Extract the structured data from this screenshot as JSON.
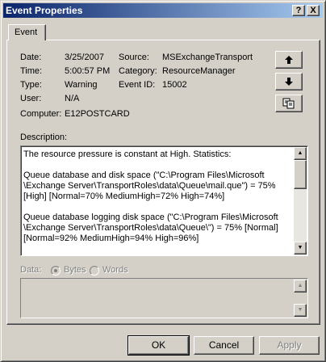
{
  "window": {
    "title": "Event Properties",
    "help_button": "?",
    "close_button": "X"
  },
  "tabs": [
    {
      "label": "Event"
    }
  ],
  "event": {
    "date_label": "Date:",
    "date": "3/25/2007",
    "source_label": "Source:",
    "source": "MSExchangeTransport",
    "time_label": "Time:",
    "time": "5:00:57 PM",
    "category_label": "Category:",
    "category": "ResourceManager",
    "type_label": "Type:",
    "type": "Warning",
    "event_id_label": "Event ID:",
    "event_id": "15002",
    "user_label": "User:",
    "user": "N/A",
    "computer_label": "Computer:",
    "computer": "E12POSTCARD"
  },
  "nav_buttons": {
    "previous_icon": "up-arrow-icon",
    "next_icon": "down-arrow-icon",
    "copy_icon": "copy-icon"
  },
  "description": {
    "label": "Description:",
    "text": "The resource pressure is constant at High. Statistics:\n\nQueue database and disk space (\"C:\\Program Files\\Microsoft\n\\Exchange Server\\TransportRoles\\data\\Queue\\mail.que\") = 75%\n[High] [Normal=70% MediumHigh=72% High=74%]\n\nQueue database logging disk space (\"C:\\Program Files\\Microsoft\n\\Exchange Server\\TransportRoles\\data\\Queue\\\") = 75% [Normal]\n[Normal=92% MediumHigh=94% High=96%]"
  },
  "data_section": {
    "label": "Data:",
    "bytes_option": "Bytes",
    "words_option": "Words",
    "selected": "Bytes"
  },
  "buttons": {
    "ok": "OK",
    "cancel": "Cancel",
    "apply": "Apply"
  }
}
